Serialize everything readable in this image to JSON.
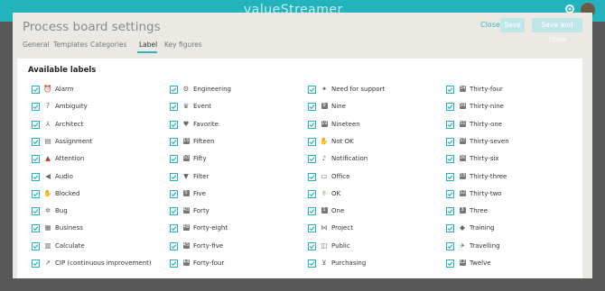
{
  "app": {
    "logo_text": "valueStreamer"
  },
  "dialog": {
    "title": "Process board settings",
    "close_label": "Close",
    "save_label": "Save",
    "save_close_label": "Save and close",
    "tabs": [
      {
        "label": "General",
        "active": false
      },
      {
        "label": "Templates",
        "active": false
      },
      {
        "label": "Categories",
        "active": false
      },
      {
        "label": "Label",
        "active": true
      },
      {
        "label": "Key figures",
        "active": false
      }
    ],
    "panel_title": "Available labels",
    "labels": [
      {
        "label": "Alarm",
        "icon": "alarm-icon",
        "checked": true
      },
      {
        "label": "Ambiguity",
        "icon": "question-icon",
        "checked": true
      },
      {
        "label": "Architect",
        "icon": "compass-icon",
        "checked": true
      },
      {
        "label": "Assignment",
        "icon": "clipboard-icon",
        "checked": true
      },
      {
        "label": "Attention",
        "icon": "warning-icon",
        "checked": true
      },
      {
        "label": "Audio",
        "icon": "speaker-icon",
        "checked": true
      },
      {
        "label": "Blocked",
        "icon": "hand-icon",
        "checked": true
      },
      {
        "label": "Bug",
        "icon": "bug-icon",
        "checked": true
      },
      {
        "label": "Business",
        "icon": "building-icon",
        "checked": true
      },
      {
        "label": "Calculate",
        "icon": "calculator-icon",
        "checked": true
      },
      {
        "label": "CIP (continuous improvement)",
        "icon": "trend-icon",
        "checked": true
      },
      {
        "label": "Engineering",
        "icon": "engineer-icon",
        "checked": true
      },
      {
        "label": "Event",
        "icon": "trophy-icon",
        "checked": true
      },
      {
        "label": "Favorite",
        "icon": "heart-icon",
        "checked": true
      },
      {
        "label": "Fifteen",
        "icon": "number-15-icon",
        "checked": true
      },
      {
        "label": "Fifty",
        "icon": "number-50-icon",
        "checked": true
      },
      {
        "label": "Filter",
        "icon": "filter-icon",
        "checked": true
      },
      {
        "label": "Five",
        "icon": "number-5-icon",
        "checked": true
      },
      {
        "label": "Forty",
        "icon": "number-40-icon",
        "checked": true
      },
      {
        "label": "Forty-eight",
        "icon": "number-48-icon",
        "checked": true
      },
      {
        "label": "Forty-five",
        "icon": "number-45-icon",
        "checked": true
      },
      {
        "label": "Forty-four",
        "icon": "number-44-icon",
        "checked": true
      },
      {
        "label": "Need for support",
        "icon": "support-icon",
        "checked": true
      },
      {
        "label": "Nine",
        "icon": "number-9-icon",
        "checked": true
      },
      {
        "label": "Nineteen",
        "icon": "number-19-icon",
        "checked": true
      },
      {
        "label": "Not OK",
        "icon": "thumbs-down-icon",
        "checked": true
      },
      {
        "label": "Notification",
        "icon": "bell-icon",
        "checked": true
      },
      {
        "label": "Office",
        "icon": "monitor-icon",
        "checked": true
      },
      {
        "label": "OK",
        "icon": "thumbs-up-icon",
        "checked": true
      },
      {
        "label": "One",
        "icon": "number-1-icon",
        "checked": true
      },
      {
        "label": "Project",
        "icon": "network-icon",
        "checked": true
      },
      {
        "label": "Public",
        "icon": "lock-icon",
        "checked": true
      },
      {
        "label": "Purchasing",
        "icon": "cart-icon",
        "checked": true
      },
      {
        "label": "Thirty-four",
        "icon": "number-34-icon",
        "checked": true
      },
      {
        "label": "Thirty-nine",
        "icon": "number-39-icon",
        "checked": true
      },
      {
        "label": "Thirty-one",
        "icon": "number-31-icon",
        "checked": true
      },
      {
        "label": "Thirty-seven",
        "icon": "number-37-icon",
        "checked": true
      },
      {
        "label": "Thirty-six",
        "icon": "number-36-icon",
        "checked": true
      },
      {
        "label": "Thirty-three",
        "icon": "number-33-icon",
        "checked": true
      },
      {
        "label": "Thirty-two",
        "icon": "number-32-icon",
        "checked": true
      },
      {
        "label": "Three",
        "icon": "number-3-icon",
        "checked": true
      },
      {
        "label": "Training",
        "icon": "graduation-icon",
        "checked": true
      },
      {
        "label": "Travelling",
        "icon": "airplane-icon",
        "checked": true
      },
      {
        "label": "Twelve",
        "icon": "number-12-icon",
        "checked": true
      }
    ]
  },
  "colors": {
    "accent": "#22b3bd",
    "header": "#22b3bd",
    "danger": "#c0392b",
    "success": "#2e9e3f"
  }
}
